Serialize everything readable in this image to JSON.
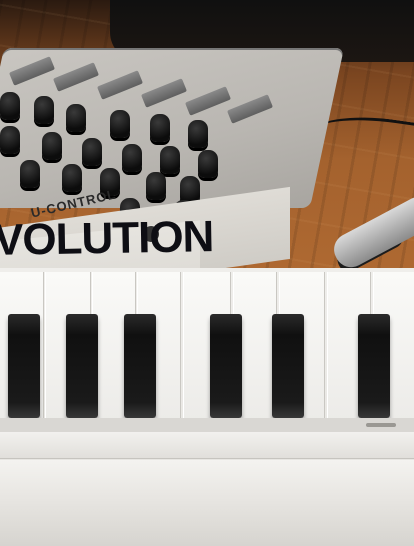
{
  "image": {
    "brand_text": "U-CONTROL",
    "device_text": "VOLUTION"
  },
  "colors": {
    "floor": "#a4622e",
    "controller_body": "#c9c6c1",
    "knob": "#111111",
    "keyboard_white": "#f4f3f0",
    "black_key": "#151515"
  }
}
